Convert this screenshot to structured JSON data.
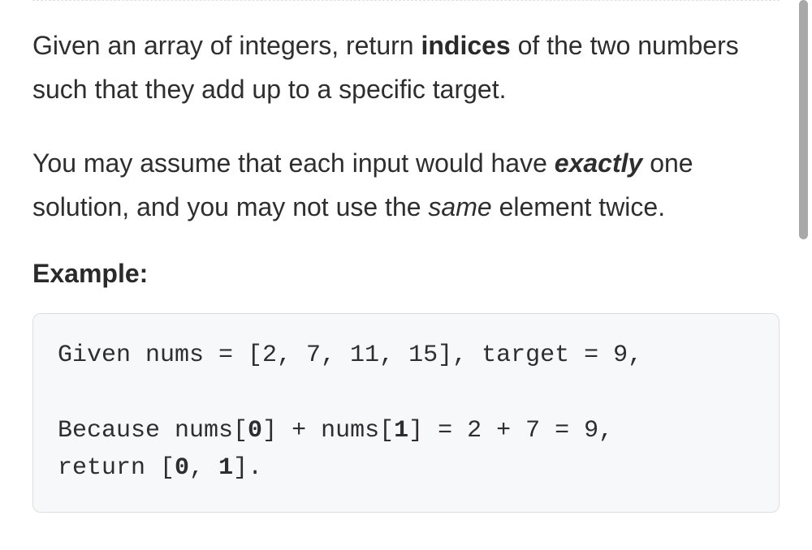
{
  "problem": {
    "paragraph1": {
      "pre": "Given an array of integers, return ",
      "bold": "indices",
      "post": " of the two numbers such that they add up to a specific target."
    },
    "paragraph2": {
      "pre": "You may assume that each input would have ",
      "emStrong": "exactly",
      "mid": " one solution, and you may not use the ",
      "em": "same",
      "post": " element twice."
    },
    "exampleLabel": "Example:",
    "code": {
      "line1_a": "Given nums = [2, 7, 11, 15], target = 9,",
      "blank": "",
      "line2_pre": "Because nums[",
      "line2_d0": "0",
      "line2_mid1": "] + nums[",
      "line2_d1": "1",
      "line2_post": "] = 2 + 7 = 9,",
      "line3_pre": "return [",
      "line3_d0": "0",
      "line3_mid": ", ",
      "line3_d1": "1",
      "line3_post": "]."
    }
  }
}
